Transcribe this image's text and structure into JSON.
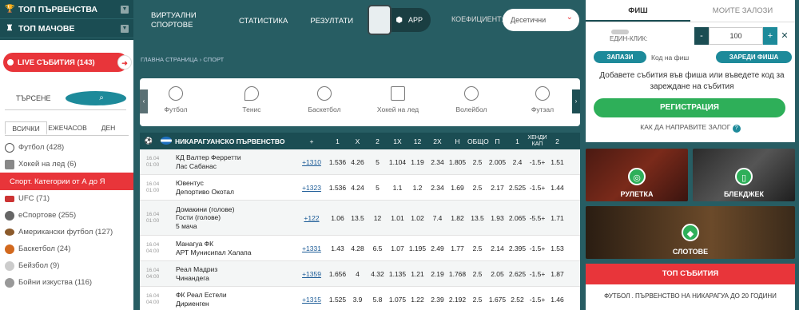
{
  "left": {
    "top_leagues": "ТОП ПЪРВЕНСТВА",
    "top_matches": "ТОП МАЧОВЕ",
    "live": "LIVE СЪБИТИЯ (143)",
    "search_placeholder": "ТЪРСЕНЕ",
    "tabs": [
      "ВСИЧКИ",
      "ЕЖЕЧАСОВ",
      "ДЕН"
    ],
    "sports": [
      {
        "label": "Футбол (428)",
        "color": "#555"
      },
      {
        "label": "Хокей на лед (6)",
        "color": "#777"
      },
      {
        "label": "Спорт. Категории от А до Я",
        "color": "#e8353a"
      },
      {
        "label": "UFC (71)",
        "color": "#c33"
      },
      {
        "label": "еСпортове (255)",
        "color": "#666"
      },
      {
        "label": "Американски футбол (127)",
        "color": "#8b5a2b"
      },
      {
        "label": "Баскетбол (24)",
        "color": "#d2691e"
      },
      {
        "label": "Бейзбол (9)",
        "color": "#bbb"
      },
      {
        "label": "Бойни изкуства (116)",
        "color": "#888"
      }
    ]
  },
  "nav": {
    "brand_1": "ВИРТУАЛНИ",
    "brand_2": "СПОРТОВЕ",
    "stats": "СТАТИСТИКА",
    "results": "РЕЗУЛТАТИ",
    "app": "APP",
    "coef_label": "КОЕФИЦИЕНТ:",
    "coef_value": "Десетични",
    "breadcrumb": "ГЛАВНА СТРАНИЦА › СПОРТ"
  },
  "sports_bar": [
    "Футбол",
    "Тенис",
    "Баскетбол",
    "Хокей на лед",
    "Волейбол",
    "Футзал"
  ],
  "table": {
    "league": "НИКАРАГУАНСКО ПЪРВЕНСТВО",
    "headers": [
      "+",
      "1",
      "X",
      "2",
      "1X",
      "12",
      "2X",
      "Н",
      "ОБЩО",
      "П",
      "1",
      "ХЕНДИ КАП",
      "2"
    ],
    "rows": [
      {
        "date": "16.04",
        "time": "01:00",
        "team1": "КД Валтер Ферретти",
        "team2": "Лас Сабанас",
        "team3": "",
        "more": "+1310",
        "odds": [
          "1.536",
          "4.26",
          "5",
          "1.104",
          "1.19",
          "2.34",
          "1.805",
          "2.5",
          "2.005",
          "2.4",
          "-1.5+",
          "1.51"
        ]
      },
      {
        "date": "16.04",
        "time": "01:00",
        "team1": "Ювентус",
        "team2": "Депортиво Окотал",
        "team3": "",
        "more": "+1323",
        "odds": [
          "1.536",
          "4.24",
          "5",
          "1.1",
          "1.2",
          "2.34",
          "1.69",
          "2.5",
          "2.17",
          "2.525",
          "-1.5+",
          "1.44"
        ]
      },
      {
        "date": "16.04",
        "time": "01:00",
        "team1": "Домакини (голове)",
        "team2": "Гости (голове)",
        "team3": "5 мача",
        "more": "+122",
        "odds": [
          "1.06",
          "13.5",
          "12",
          "1.01",
          "1.02",
          "7.4",
          "1.82",
          "13.5",
          "1.93",
          "2.065",
          "-5.5+",
          "1.71"
        ]
      },
      {
        "date": "16.04",
        "time": "04:00",
        "team1": "Манагуа ФК",
        "team2": "АРТ Мунисипал Халапа",
        "team3": "",
        "more": "+1331",
        "odds": [
          "1.43",
          "4.28",
          "6.5",
          "1.07",
          "1.195",
          "2.49",
          "1.77",
          "2.5",
          "2.14",
          "2.395",
          "-1.5+",
          "1.53"
        ]
      },
      {
        "date": "16.04",
        "time": "04:00",
        "team1": "Реал Мадриз",
        "team2": "Чинандега",
        "team3": "",
        "more": "+1359",
        "odds": [
          "1.656",
          "4",
          "4.32",
          "1.135",
          "1.21",
          "2.19",
          "1.768",
          "2.5",
          "2.05",
          "2.625",
          "-1.5+",
          "1.87"
        ]
      },
      {
        "date": "16.04",
        "time": "04:00",
        "team1": "ФК Реал Естели",
        "team2": "Дириенген",
        "team3": "",
        "more": "+1315",
        "odds": [
          "1.525",
          "3.9",
          "5.8",
          "1.075",
          "1.22",
          "2.39",
          "2.192",
          "2.5",
          "1.675",
          "2.52",
          "-1.5+",
          "1.46"
        ]
      }
    ]
  },
  "slip": {
    "tab_slip": "ФИШ",
    "tab_bets": "МОИТЕ ЗАЛОЗИ",
    "one_click": "ЕДИН-КЛИК:",
    "stake": "100",
    "save": "ЗАПАЗИ",
    "code": "Код на фиш",
    "load": "ЗАРЕДИ ФИША",
    "hint": "Добавете събития във фиша или въведете код за зареждане на събития",
    "register": "РЕГИСТРАЦИЯ",
    "how": "КАК ДА НАПРАВИТЕ ЗАЛОГ"
  },
  "promos": {
    "roulette": "РУЛЕТКА",
    "blackjack": "БЛЕКДЖЕК",
    "slots": "СЛОТОВЕ"
  },
  "top_events": {
    "title": "ТОП СЪБИТИЯ",
    "item": "ФУТБОЛ . ПЪРВЕНСТВО НА НИКАРАГУА ДО 20 ГОДИНИ"
  }
}
